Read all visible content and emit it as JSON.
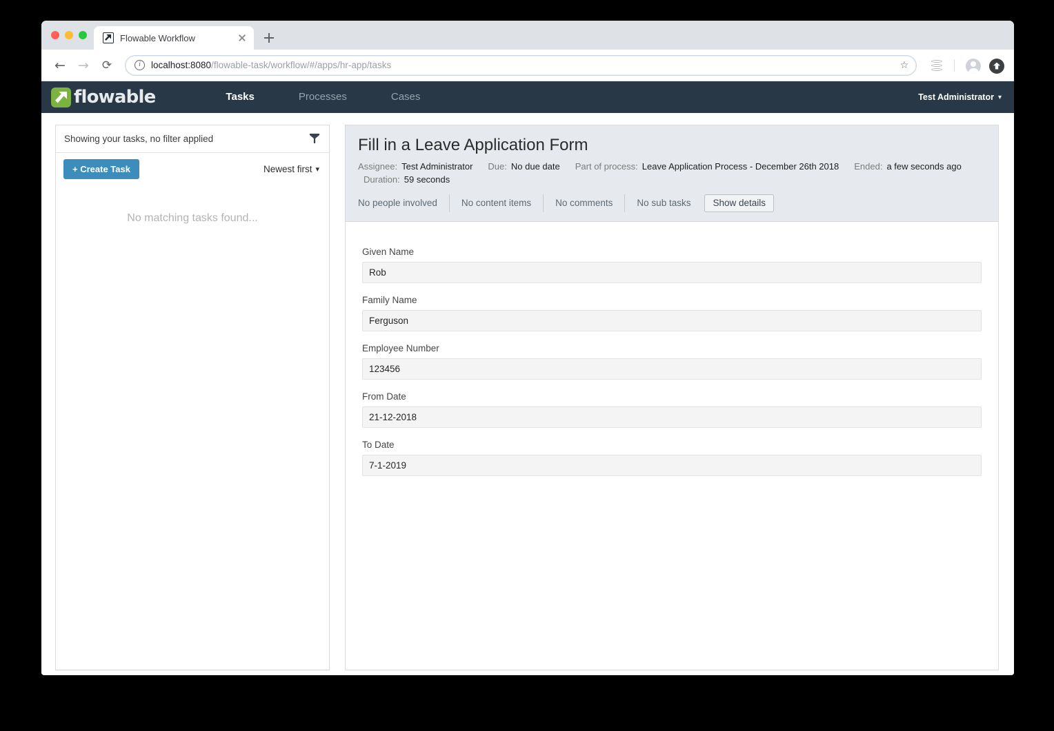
{
  "browser": {
    "tab_title": "Flowable Workflow",
    "favicon": "flowable-favicon-icon",
    "back_glyph": "←",
    "forward_glyph": "→",
    "reload_glyph": "⟳",
    "url_host": "localhost:8080",
    "url_path": "/flowable-task/workflow/#/apps/hr-app/tasks",
    "url_full": "localhost:8080/flowable-task/workflow/#/apps/hr-app/tasks",
    "info_glyph": "i",
    "bookmark_glyph": "☆",
    "new_tab_glyph": "+",
    "icons": {
      "database": "database-icon",
      "profile": "profile-avatar-icon",
      "update": "update-icon"
    }
  },
  "navbar": {
    "brand": "flowable",
    "links": [
      {
        "label": "Tasks",
        "active": true
      },
      {
        "label": "Processes",
        "active": false
      },
      {
        "label": "Cases",
        "active": false
      }
    ],
    "user": "Test Administrator",
    "user_caret": "❯"
  },
  "task_list": {
    "filter_label": "Showing your tasks, no filter applied",
    "filter_icon": "funnel-icon",
    "create_task_label": "+ Create Task",
    "sort_label": "Newest first",
    "sort_caret": "❯",
    "empty_message": "No matching tasks found..."
  },
  "task_detail": {
    "title": "Fill in a Leave Application Form",
    "meta": [
      {
        "key": "Assignee:",
        "value": "Test Administrator"
      },
      {
        "key": "Due:",
        "value": "No due date"
      },
      {
        "key": "Part of process:",
        "value": "Leave Application Process - December 26th 2018"
      },
      {
        "key": "Ended:",
        "value": "a few seconds ago"
      },
      {
        "key": "Duration:",
        "value": "59 seconds"
      }
    ],
    "tabs": [
      "No people involved",
      "No content items",
      "No comments",
      "No sub tasks"
    ],
    "show_details_label": "Show details",
    "form_fields": [
      {
        "label": "Given Name",
        "value": "Rob"
      },
      {
        "label": "Family Name",
        "value": "Ferguson"
      },
      {
        "label": "Employee Number",
        "value": "123456"
      },
      {
        "label": "From Date",
        "value": "21-12-2018"
      },
      {
        "label": "To Date",
        "value": "7-1-2019"
      }
    ]
  },
  "colors": {
    "navbar_bg": "#293846",
    "brand_green": "#7bb241",
    "primary_button": "#3c8dbc",
    "detail_header_bg": "#e6eaee",
    "input_bg": "#f4f4f4"
  }
}
